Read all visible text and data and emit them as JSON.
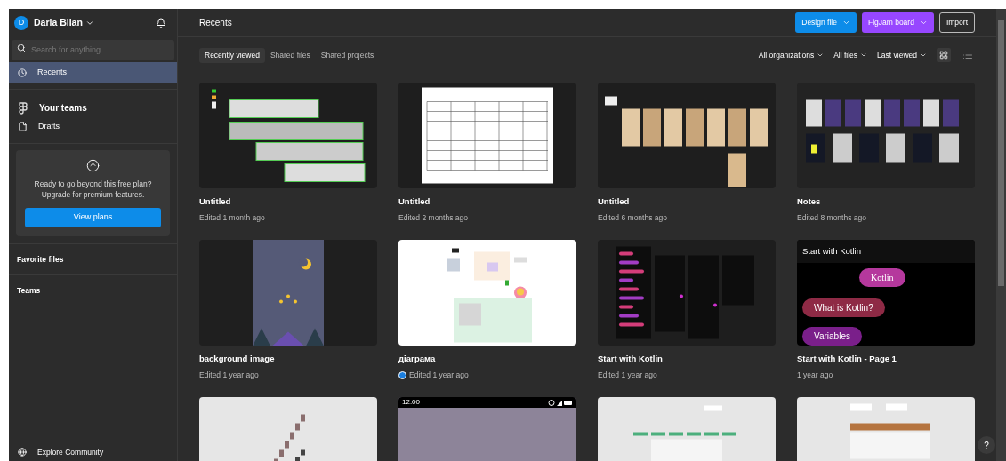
{
  "sidebar": {
    "user": {
      "initial": "D",
      "name": "Daria Bilan"
    },
    "search": {
      "placeholder": "Search for anything"
    },
    "nav": [
      {
        "label": "Recents",
        "selected": true
      }
    ],
    "links": [
      {
        "label": "Your teams"
      },
      {
        "label": "Drafts"
      }
    ],
    "upgrade": {
      "text": "Ready to go beyond this free plan? Upgrade for premium features.",
      "button": "View plans"
    },
    "sections": [
      "Favorite files",
      "Teams"
    ],
    "footer": "Explore Community"
  },
  "header": {
    "title": "Recents",
    "buttons": [
      {
        "label": "Design file",
        "kind": "design"
      },
      {
        "label": "FigJam board",
        "kind": "figjam"
      },
      {
        "label": "Import",
        "kind": "plain"
      }
    ]
  },
  "tabs": [
    {
      "label": "Recently viewed",
      "selected": true
    },
    {
      "label": "Shared files",
      "selected": false
    },
    {
      "label": "Shared projects",
      "selected": false
    }
  ],
  "filters": [
    "All organizations",
    "All files",
    "Last viewed"
  ],
  "view": {
    "grid": true
  },
  "files": [
    {
      "title": "Untitled",
      "subtitle": "Edited 1 month ago",
      "shared": false,
      "thumb": {
        "kind": "frames"
      }
    },
    {
      "title": "Untitled",
      "subtitle": "Edited 2 months ago",
      "shared": false,
      "thumb": {
        "kind": "table"
      }
    },
    {
      "title": "Untitled",
      "subtitle": "Edited 6 months ago",
      "shared": false,
      "thumb": {
        "kind": "beige"
      }
    },
    {
      "title": "Notes",
      "subtitle": "Edited 8 months ago",
      "shared": false,
      "thumb": {
        "kind": "purple"
      }
    },
    {
      "title": "background image",
      "subtitle": "Edited 1 year ago",
      "shared": false,
      "thumb": {
        "kind": "night"
      }
    },
    {
      "title": "діаграма",
      "subtitle": "Edited 1 year ago",
      "shared": true,
      "thumb": {
        "kind": "board"
      }
    },
    {
      "title": "Start with Kotlin",
      "subtitle": "Edited 1 year ago",
      "shared": false,
      "thumb": {
        "kind": "dark"
      }
    },
    {
      "title": "Start with Kotlin - Page 1",
      "subtitle": "1 year ago",
      "shared": false,
      "thumb": {
        "kind": "kotlin",
        "heading": "Start with Kotlin",
        "pills": [
          {
            "text": "Kotlin",
            "color": "#b5389d"
          },
          {
            "text": "What is Kotlin?",
            "color": "#8e2a45"
          },
          {
            "text": "Variables",
            "color": "#7a1f8a"
          }
        ]
      }
    },
    {
      "thumb": {
        "kind": "stairs"
      }
    },
    {
      "thumb": {
        "kind": "phone",
        "time": "12:00"
      }
    },
    {
      "thumb": {
        "kind": "flow"
      }
    },
    {
      "thumb": {
        "kind": "diagram"
      }
    }
  ],
  "help": "?"
}
